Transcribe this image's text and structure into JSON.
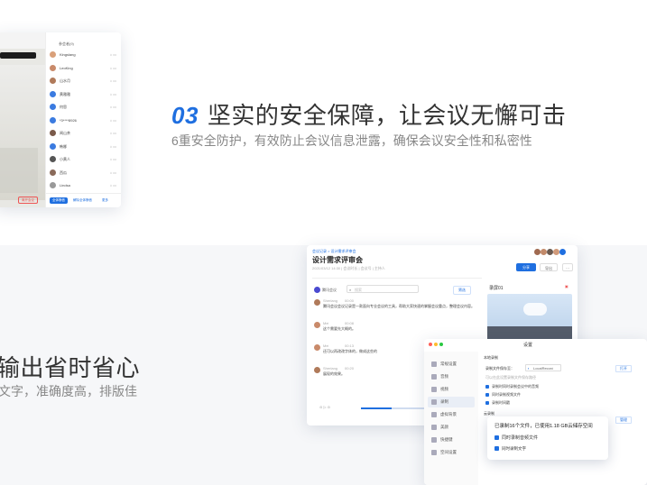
{
  "feature3": {
    "number": "03",
    "title": "坚实的安全保障，让会议无懈可击",
    "subtitle": "6重安全防护，有效防止会议信息泄露，确保会议安全性和私密性"
  },
  "feature4": {
    "title_partial": "输出省时省心",
    "subtitle_partial": "文字，准确度高，排版佳"
  },
  "left_card": {
    "toolbar": [
      "会议信息",
      "..."
    ],
    "side_header": "参会者(9)",
    "members": [
      {
        "name": "Kingslang",
        "color": "#d9a07a"
      },
      {
        "name": "LeoKing",
        "color": "#c98a6a"
      },
      {
        "name": "山水月",
        "color": "#b07a5a"
      },
      {
        "name": "黄雅雅",
        "color": "#3b7be0"
      },
      {
        "name": "何思",
        "color": "#3b7be0"
      },
      {
        "name": "*3****8926",
        "color": "#3b7be0"
      },
      {
        "name": "闻山茶",
        "color": "#7a5a4a"
      },
      {
        "name": "韩娜",
        "color": "#3b7be0"
      },
      {
        "name": "小黄人",
        "color": "#555"
      },
      {
        "name": "西瓜",
        "color": "#8a6a5a"
      },
      {
        "name": "Lindsa",
        "color": "#999"
      }
    ],
    "footer_buttons": [
      "全体静音",
      "解除全体静音",
      "更多"
    ],
    "leave_button": "离开会议"
  },
  "right_card": {
    "breadcrumb": "会议记录 > 设计需求评审会",
    "title": "设计需求评审会",
    "meta": "2021/03/12 14:30 | 会议时长 | 会议号 | 主持人",
    "buttons": {
      "share": "分享",
      "export": "导出",
      "more": "···"
    },
    "chat_label": "腾讯会议",
    "search_placeholder": "搜索",
    "filter_label": "筛选",
    "video_title": "录屏01",
    "messages": [
      {
        "speaker": "Sherlang",
        "time": "00:00",
        "text": "腾讯会议会议记录是一款面向专业会议的工具，帮助大家快速的掌握会议重点，整理会议内容。"
      },
      {
        "speaker": "Mei",
        "time": "00:08",
        "text": "这个需要先大概的。"
      },
      {
        "speaker": "Mei",
        "time": "00:13",
        "text": "还可以再改改字体的，做成这些的"
      },
      {
        "speaker": "Sherlang",
        "time": "00:20",
        "text": "展现的效果。"
      }
    ]
  },
  "settings": {
    "title": "设置",
    "menu": [
      "常规设置",
      "音频",
      "视频",
      "录制",
      "虚拟背景",
      "美颜",
      "快捷键",
      "空间设置"
    ],
    "active_index": 3,
    "section": "本地录制",
    "path_label": "录制文件保存至：",
    "path_value": "LocalRecord",
    "open_button": "打开",
    "hint": "可以在此设置录制文件保存路径",
    "options": [
      "录制时同时录制会议中的音频",
      "同时录制视频文件",
      "录制时间戳"
    ],
    "section2": "云录制",
    "cloud_button": "管理"
  },
  "popup": {
    "text": "已录制16个文件，已使用1.18 GB云储存空间",
    "option1": "同时录制音频文件",
    "option2": "同时录制文字"
  }
}
